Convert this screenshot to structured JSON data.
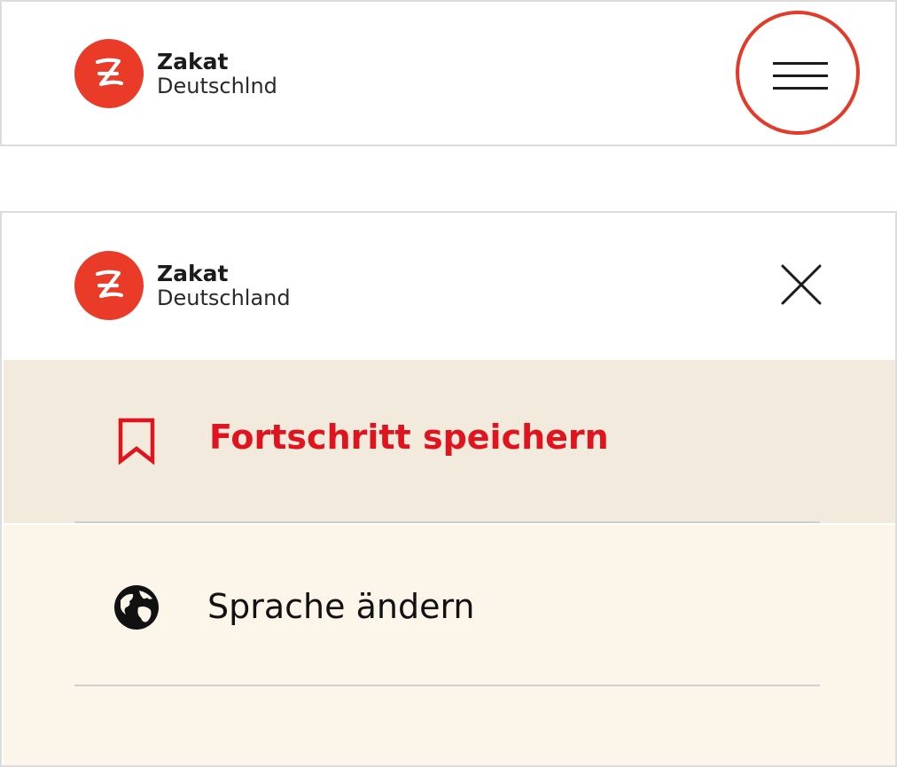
{
  "colors": {
    "brand_red": "#ea3a28",
    "highlight_ring": "#e33a2a",
    "save_text": "#e0141e",
    "save_bg": "#f2eadc",
    "lang_bg": "#fcf6ea",
    "divider": "#cfcfcf"
  },
  "header_closed": {
    "logo": {
      "line1": "Zakat",
      "line2": "Deutschlnd",
      "icon": "zakat-z-logo"
    },
    "menu_button": {
      "icon": "hamburger-icon",
      "highlighted": true
    }
  },
  "header_open": {
    "logo": {
      "line1": "Zakat",
      "line2": "Deutschland",
      "icon": "zakat-z-logo"
    },
    "close_button": {
      "icon": "close-icon"
    }
  },
  "menu": {
    "items": [
      {
        "label": "Fortschritt speichern",
        "icon": "bookmark-icon"
      },
      {
        "label": "Sprache ändern",
        "icon": "globe-icon"
      }
    ]
  }
}
